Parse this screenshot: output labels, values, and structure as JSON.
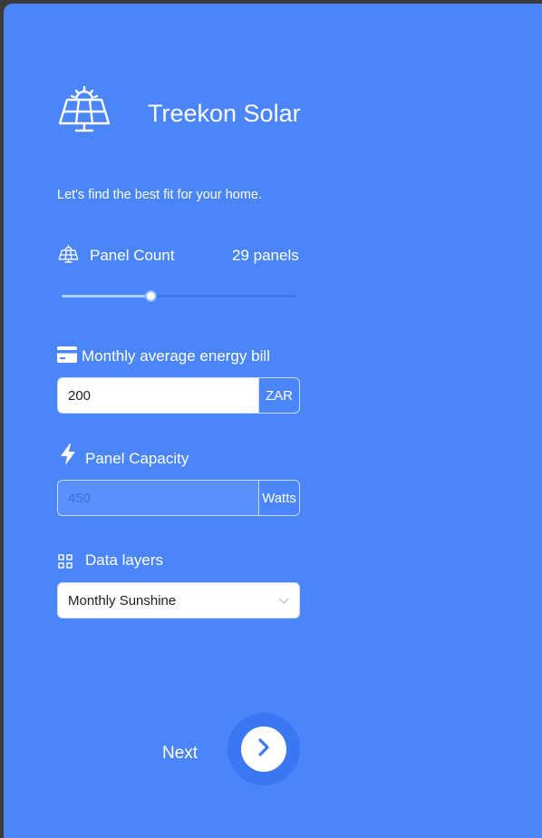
{
  "brand": {
    "title": "Treekon Solar",
    "logo_icon": "solar-panel-icon"
  },
  "subtitle": "Let's find the best fit for your home.",
  "panel_count": {
    "icon": "solar-panel-icon",
    "label": "Panel Count",
    "value_text": "29 panels",
    "slider_fraction": 0.38
  },
  "energy_bill": {
    "icon": "credit-card-icon",
    "label": "Monthly average energy bill",
    "value": "200",
    "unit": "ZAR"
  },
  "panel_capacity": {
    "icon": "lightning-icon",
    "label": "Panel Capacity",
    "placeholder": "450",
    "unit": "Watts"
  },
  "data_layers": {
    "icon": "grid-icon",
    "label": "Data layers",
    "selected": "Monthly Sunshine"
  },
  "next": {
    "label": "Next",
    "icon": "chevron-right-icon"
  },
  "colors": {
    "background": "#4a86fa",
    "button": "#3a77f3",
    "accent": "#ffffff"
  }
}
